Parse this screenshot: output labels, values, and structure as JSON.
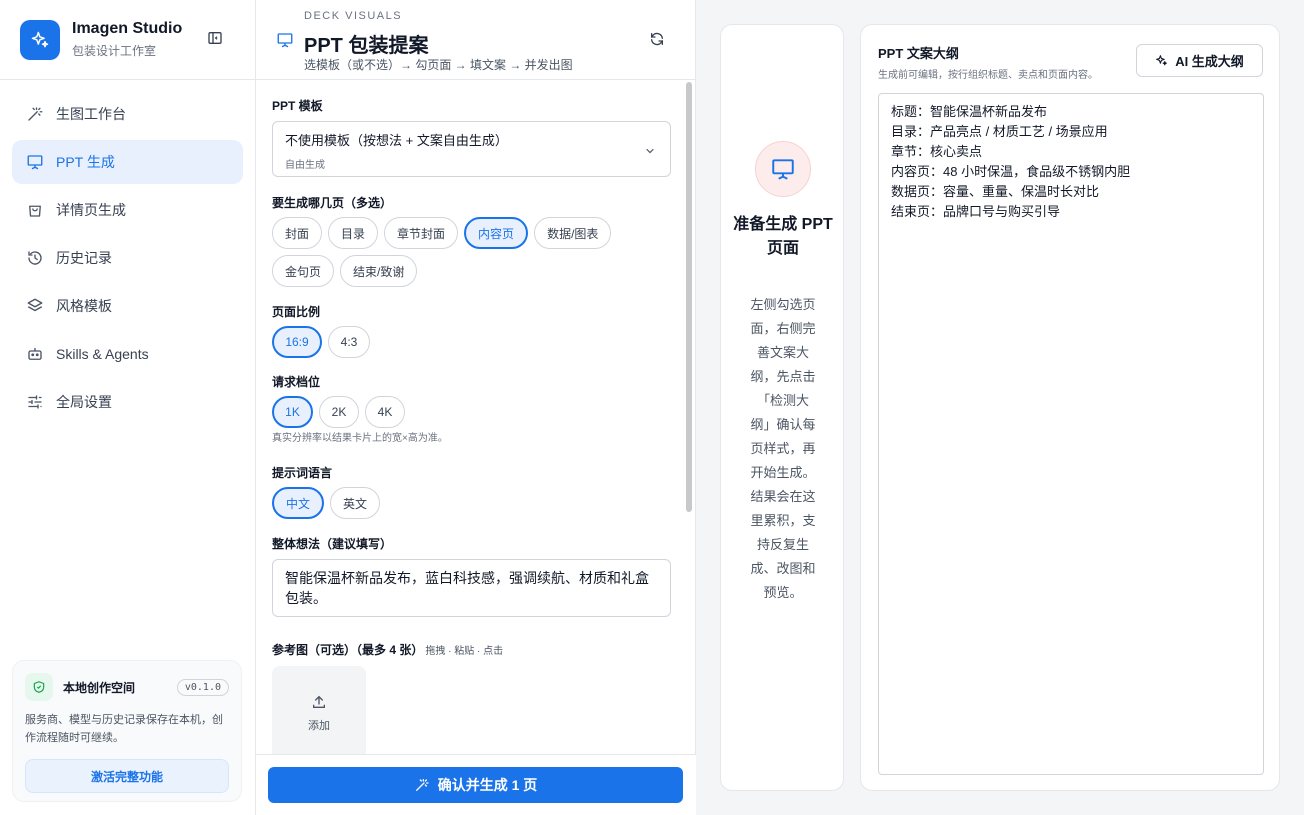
{
  "brand": {
    "title": "Imagen Studio",
    "subtitle": "包装设计工作室"
  },
  "nav": [
    {
      "label": "生图工作台",
      "icon": "magic-wand-icon",
      "active": false
    },
    {
      "label": "PPT 生成",
      "icon": "presentation-icon",
      "active": true
    },
    {
      "label": "详情页生成",
      "icon": "shopping-bag-icon",
      "active": false
    },
    {
      "label": "历史记录",
      "icon": "history-icon",
      "active": false
    },
    {
      "label": "风格模板",
      "icon": "layers-icon",
      "active": false
    },
    {
      "label": "Skills & Agents",
      "icon": "robot-icon",
      "active": false
    },
    {
      "label": "全局设置",
      "icon": "sliders-icon",
      "active": false
    }
  ],
  "workspace": {
    "title": "本地创作空间",
    "version": "v0.1.0",
    "description": "服务商、模型与历史记录保存在本机，创作流程随时可继续。",
    "button": "激活完整功能"
  },
  "panel": {
    "eyebrow": "DECK VISUALS",
    "title": "PPT 包装提案",
    "subtitle": "选模板（或不选）→ 勾页面 → 填文案 → 并发出图"
  },
  "form": {
    "template_label": "PPT 模板",
    "template_value": "不使用模板（按想法 + 文案自由生成）",
    "template_sub": "自由生成",
    "pages_label": "要生成哪几页（多选）",
    "pages": [
      {
        "label": "封面",
        "selected": false
      },
      {
        "label": "目录",
        "selected": false
      },
      {
        "label": "章节封面",
        "selected": false
      },
      {
        "label": "内容页",
        "selected": true
      },
      {
        "label": "数据/图表",
        "selected": false
      },
      {
        "label": "金句页",
        "selected": false
      },
      {
        "label": "结束/致谢",
        "selected": false
      }
    ],
    "ratio_label": "页面比例",
    "ratios": [
      {
        "label": "16:9",
        "selected": true
      },
      {
        "label": "4:3",
        "selected": false
      }
    ],
    "tier_label": "请求档位",
    "tiers": [
      {
        "label": "1K",
        "selected": true
      },
      {
        "label": "2K",
        "selected": false
      },
      {
        "label": "4K",
        "selected": false
      }
    ],
    "tier_hint": "真实分辨率以结果卡片上的宽×高为准。",
    "lang_label": "提示词语言",
    "langs": [
      {
        "label": "中文",
        "selected": true
      },
      {
        "label": "英文",
        "selected": false
      }
    ],
    "idea_label": "整体想法（建议填写）",
    "idea_value": "智能保温杯新品发布，蓝白科技感，强调续航、材质和礼盒包装。",
    "ref_label": "参考图（可选）（最多 4 张）",
    "ref_hint": "拖拽 · 粘贴 · 点击",
    "upload_label": "添加",
    "submit": "确认并生成 1 页"
  },
  "prep": {
    "title": "准备生成 PPT 页面",
    "description": "左侧勾选页面，右侧完善文案大纲，先点击「检测大纲」确认每页样式，再开始生成。结果会在这里累积，支持反复生成、改图和预览。"
  },
  "outline": {
    "title": "PPT 文案大纲",
    "subtitle": "生成前可编辑，按行组织标题、卖点和页面内容。",
    "ai_button": "AI 生成大纲",
    "lines": [
      "标题：智能保温杯新品发布",
      "目录：产品亮点 / 材质工艺 / 场景应用",
      "章节：核心卖点",
      "内容页：48 小时保温，食品级不锈钢内胆",
      "数据页：容量、重量、保温时长对比",
      "结束页：品牌口号与购买引导"
    ]
  },
  "colors": {
    "accent": "#1a73e8",
    "accent_bg": "#e8f0fe"
  }
}
